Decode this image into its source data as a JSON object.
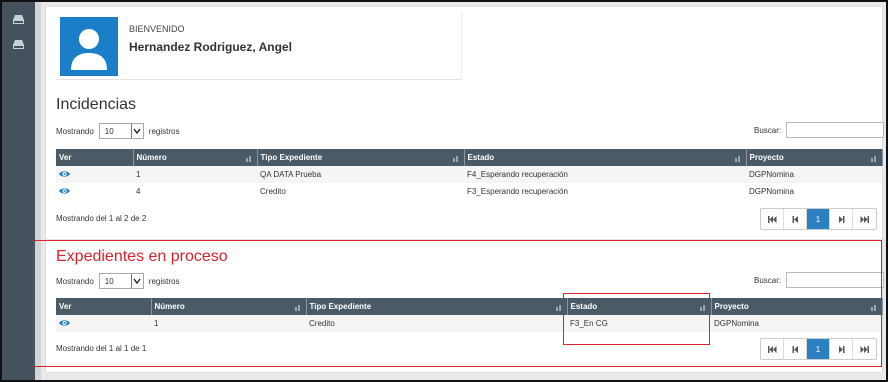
{
  "sidebar": {
    "items": [
      {
        "icon": "drive-icon"
      },
      {
        "icon": "drive-icon"
      }
    ]
  },
  "header": {
    "welcome": "BIENVENIDO",
    "user_name": "Hernandez Rodriguez, Angel"
  },
  "incidencias": {
    "title": "Incidencias",
    "length_prefix": "Mostrando",
    "length_value": "10",
    "length_suffix": "registros",
    "search_label": "Buscar:",
    "columns": [
      "Ver",
      "Número",
      "Tipo Expediente",
      "Estado",
      "Proyecto"
    ],
    "rows": [
      {
        "numero": "1",
        "tipo": "QA DATA Prueba",
        "estado": "F4_Esperando recuperación",
        "proyecto": "DGPNomina"
      },
      {
        "numero": "4",
        "tipo": "Credito",
        "estado": "F3_Esperando recuperación",
        "proyecto": "DGPNomina"
      }
    ],
    "info": "Mostrando del 1 al 2 de 2",
    "current_page": "1"
  },
  "expedientes": {
    "title": "Expedientes en proceso",
    "length_prefix": "Mostrando",
    "length_value": "10",
    "length_suffix": "registros",
    "search_label": "Buscar:",
    "columns": [
      "Ver",
      "Número",
      "Tipo Expediente",
      "Estado",
      "Proyecto"
    ],
    "rows": [
      {
        "numero": "1",
        "tipo": "Credito",
        "estado": "F3_En CG",
        "proyecto": "DGPNomina"
      }
    ],
    "info": "Mostrando del 1 al 1 de 1",
    "current_page": "1"
  },
  "colors": {
    "sidebar": "#45525d",
    "table_header": "#4a5a67",
    "avatar": "#1a7fc8",
    "highlight": "#d9232b",
    "active_page": "#2a80c1"
  }
}
